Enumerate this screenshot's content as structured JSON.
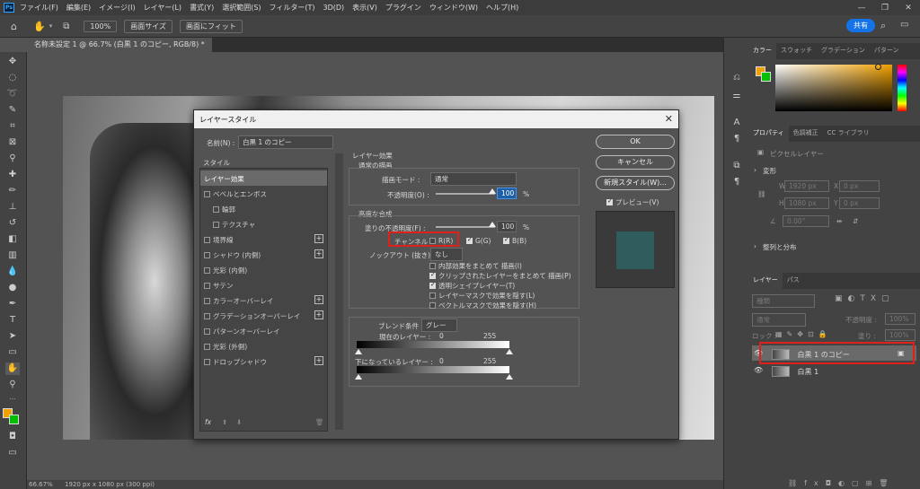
{
  "menubar": {
    "items": [
      "ファイル(F)",
      "編集(E)",
      "イメージ(I)",
      "レイヤー(L)",
      "書式(Y)",
      "選択範囲(S)",
      "フィルター(T)",
      "3D(D)",
      "表示(V)",
      "プラグイン",
      "ウィンドウ(W)",
      "ヘルプ(H)"
    ],
    "app_icon": "Ps"
  },
  "optionbar": {
    "zoom": "100%",
    "fit_screen": "画面サイズ",
    "fill_screen": "画面にフィット",
    "share": "共有"
  },
  "document": {
    "tab_title": "名称未設定 1 @ 66.7% (白黒 1 のコピー, RGB/8) *"
  },
  "statusbar": {
    "zoom": "66.67%",
    "size": "1920 px x 1080 px (300 ppi)"
  },
  "dialog": {
    "title": "レイヤースタイル",
    "name_label": "名前(N) :",
    "name_value": "白黒 1 のコピー",
    "styles_header": "スタイル",
    "styles": [
      {
        "label": "レイヤー効果",
        "selected": true,
        "checkbox": false,
        "plus": false
      },
      {
        "label": "ベベルとエンボス",
        "checkbox": true,
        "plus": false
      },
      {
        "label": "輪郭",
        "checkbox": true,
        "plus": false,
        "indent": true
      },
      {
        "label": "テクスチャ",
        "checkbox": true,
        "plus": false,
        "indent": true
      },
      {
        "label": "境界線",
        "checkbox": true,
        "plus": true
      },
      {
        "label": "シャドウ (内側)",
        "checkbox": true,
        "plus": true
      },
      {
        "label": "光彩 (内側)",
        "checkbox": true,
        "plus": false
      },
      {
        "label": "サテン",
        "checkbox": true,
        "plus": false
      },
      {
        "label": "カラーオーバーレイ",
        "checkbox": true,
        "plus": true
      },
      {
        "label": "グラデーションオーバーレイ",
        "checkbox": true,
        "plus": true
      },
      {
        "label": "パターンオーバーレイ",
        "checkbox": true,
        "plus": false
      },
      {
        "label": "光彩 (外側)",
        "checkbox": true,
        "plus": false
      },
      {
        "label": "ドロップシャドウ",
        "checkbox": true,
        "plus": true
      }
    ],
    "fx_label": "fx",
    "section_title": "レイヤー効果",
    "general": {
      "title": "通常の描画",
      "blend_label": "描画モード :",
      "blend_value": "通常",
      "opacity_label": "不透明度(O) :",
      "opacity_value": "100",
      "percent": "%"
    },
    "advanced": {
      "title": "高度な合成",
      "fill_label": "塗りの不透明度(F) :",
      "fill_value": "100",
      "percent": "%",
      "channels_label": "チャンネル :",
      "channel_r": "R(R)",
      "channel_g": "G(G)",
      "channel_b": "B(B)",
      "channel_r_checked": false,
      "channel_g_checked": true,
      "channel_b_checked": true,
      "knockout_label": "ノックアウト (抜き) :",
      "knockout_value": "なし",
      "options": [
        {
          "label": "内部効果をまとめて 描画(I)",
          "checked": false
        },
        {
          "label": "クリップされたレイヤーをまとめて 描画(P)",
          "checked": true
        },
        {
          "label": "透明シェイプレイヤー(T)",
          "checked": true
        },
        {
          "label": "レイヤーマスクで効果を隠す(L)",
          "checked": false
        },
        {
          "label": "ベクトルマスクで効果を隠す(H)",
          "checked": false
        }
      ]
    },
    "blendif": {
      "label": "ブレンド条件 :",
      "value": "グレー",
      "current_label": "現在のレイヤー :",
      "current_min": "0",
      "current_max": "255",
      "under_label": "下になっているレイヤー :",
      "under_min": "0",
      "under_max": "255"
    },
    "buttons": {
      "ok": "OK",
      "cancel": "キャンセル",
      "new_style": "新規スタイル(W)...",
      "preview": "プレビュー(V)",
      "preview_checked": true
    },
    "preview_color": "#2f5c5c"
  },
  "panels": {
    "color_tabs": [
      "カラー",
      "スウォッチ",
      "グラデーション",
      "パターン"
    ],
    "fg_color": "#f0a000",
    "bg_color": "#00c000",
    "prop_tabs": [
      "プロパティ",
      "色調補正",
      "CC ライブラリ"
    ],
    "prop_type": "ピクセルレイヤー",
    "transform_title": "変形",
    "transform": {
      "w": "1920 px",
      "x": "0 px",
      "h": "1080 px",
      "y": "0 px",
      "angle": "0.00°"
    },
    "align_title": "整列と分布",
    "layer_tabs": [
      "レイヤー",
      "パス"
    ],
    "search_placeholder": "種類",
    "blend": "通常",
    "opacity_label": "不透明度 :",
    "opacity": "100%",
    "lock_label": "ロック :",
    "fill_label": "塗り :",
    "fill": "100%",
    "layers": [
      {
        "name": "白黒 1 のコピー",
        "selected": true
      },
      {
        "name": "白黒 1",
        "selected": false
      }
    ]
  }
}
